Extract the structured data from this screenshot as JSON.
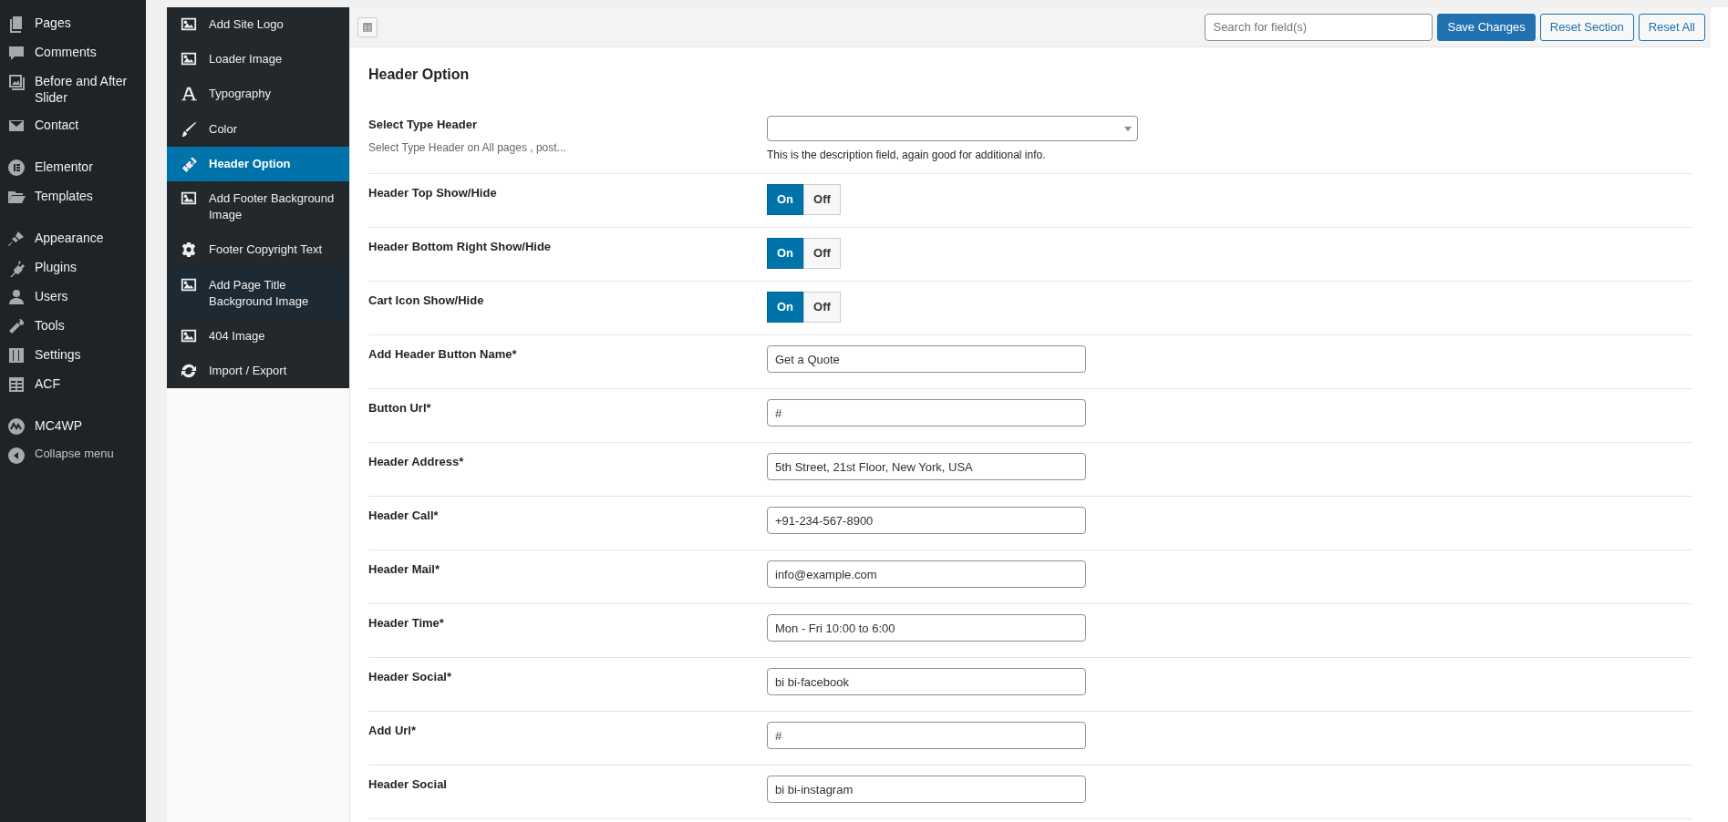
{
  "admin_menu": {
    "groups": [
      [
        {
          "label": "Pages"
        },
        {
          "label": "Comments"
        },
        {
          "label": "Before and After Slider"
        },
        {
          "label": "Contact"
        }
      ],
      [
        {
          "label": "Elementor"
        },
        {
          "label": "Templates"
        }
      ],
      [
        {
          "label": "Appearance"
        },
        {
          "label": "Plugins"
        },
        {
          "label": "Users"
        },
        {
          "label": "Tools"
        },
        {
          "label": "Settings"
        },
        {
          "label": "ACF"
        }
      ],
      [
        {
          "label": "MC4WP"
        },
        {
          "label": "Collapse menu"
        }
      ]
    ]
  },
  "options_menu": {
    "items": [
      {
        "label": "Add Site Logo",
        "selected": false
      },
      {
        "label": "Loader Image",
        "selected": false
      },
      {
        "label": "Typography",
        "selected": false
      },
      {
        "label": "Color",
        "selected": false
      },
      {
        "label": "Header Option",
        "selected": true
      },
      {
        "label": "Add Footer Background Image",
        "selected": false
      },
      {
        "label": "Footer Copyright Text",
        "selected": false
      },
      {
        "label": "Add Page Title Background Image",
        "selected": false,
        "hovered": true
      },
      {
        "label": "404 Image",
        "selected": false
      },
      {
        "label": "Import / Export",
        "selected": false
      }
    ]
  },
  "toolbar": {
    "search": {
      "placeholder": "Search for field(s)"
    },
    "buttons": [
      {
        "label": "Save Changes",
        "kind": "primary"
      },
      {
        "label": "Reset Section",
        "kind": "secondary"
      },
      {
        "label": "Reset All",
        "kind": "secondary"
      }
    ]
  },
  "section": {
    "title": "Header Option",
    "fields": [
      {
        "kind": "select",
        "label": "Select Type Header",
        "subtitle": "Select Type Header on All pages , post...",
        "description": "This is the description field, again good for additional info."
      },
      {
        "kind": "toggle",
        "label": "Header Top Show/Hide",
        "on_label": "On",
        "off_label": "Off",
        "on": true
      },
      {
        "kind": "toggle",
        "label": "Header Bottom Right Show/Hide",
        "on_label": "On",
        "off_label": "Off",
        "on": true
      },
      {
        "kind": "toggle",
        "label": "Cart Icon Show/Hide",
        "on_label": "On",
        "off_label": "Off",
        "on": true
      },
      {
        "kind": "text",
        "label": "Add Header Button Name*",
        "value": "Get a Quote"
      },
      {
        "kind": "text",
        "label": "Button Url*",
        "value": "#"
      },
      {
        "kind": "text",
        "label": "Header Address*",
        "value": "5th Street, 21st Floor, New York, USA"
      },
      {
        "kind": "text",
        "label": "Header Call*",
        "value": "+91-234-567-8900"
      },
      {
        "kind": "text",
        "label": "Header Mail*",
        "value": "info@example.com"
      },
      {
        "kind": "text",
        "label": "Header Time*",
        "value": "Mon - Fri 10:00 to 6:00"
      },
      {
        "kind": "text",
        "label": "Header Social*",
        "value": "bi bi-facebook"
      },
      {
        "kind": "text",
        "label": "Add Url*",
        "value": "#"
      },
      {
        "kind": "text",
        "label": "Header Social",
        "value": "bi bi-instagram"
      }
    ]
  }
}
